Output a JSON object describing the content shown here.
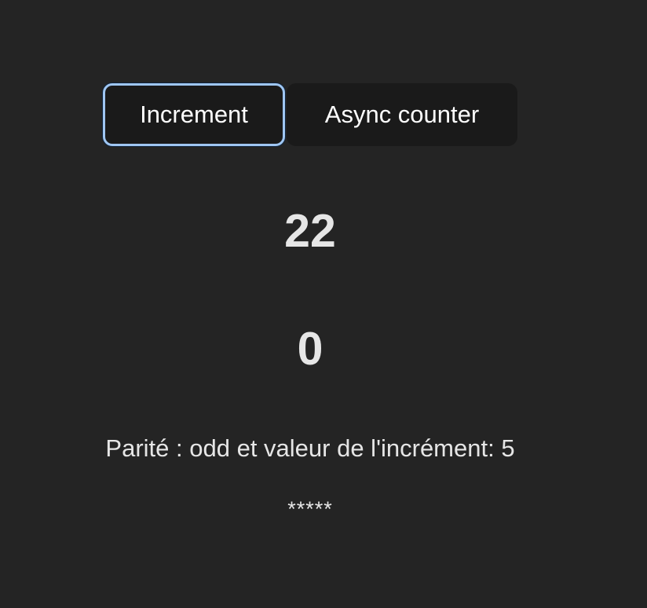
{
  "buttons": {
    "increment_label": "Increment",
    "async_label": "Async counter"
  },
  "counters": {
    "primary": "22",
    "secondary": "0"
  },
  "parity": {
    "text": "Parité : odd et valeur de l'incrément: 5"
  },
  "stars": {
    "text": "*****"
  },
  "colors": {
    "background": "#242424",
    "button_bg": "#1a1a1a",
    "focus_ring": "#9fc6f2"
  }
}
